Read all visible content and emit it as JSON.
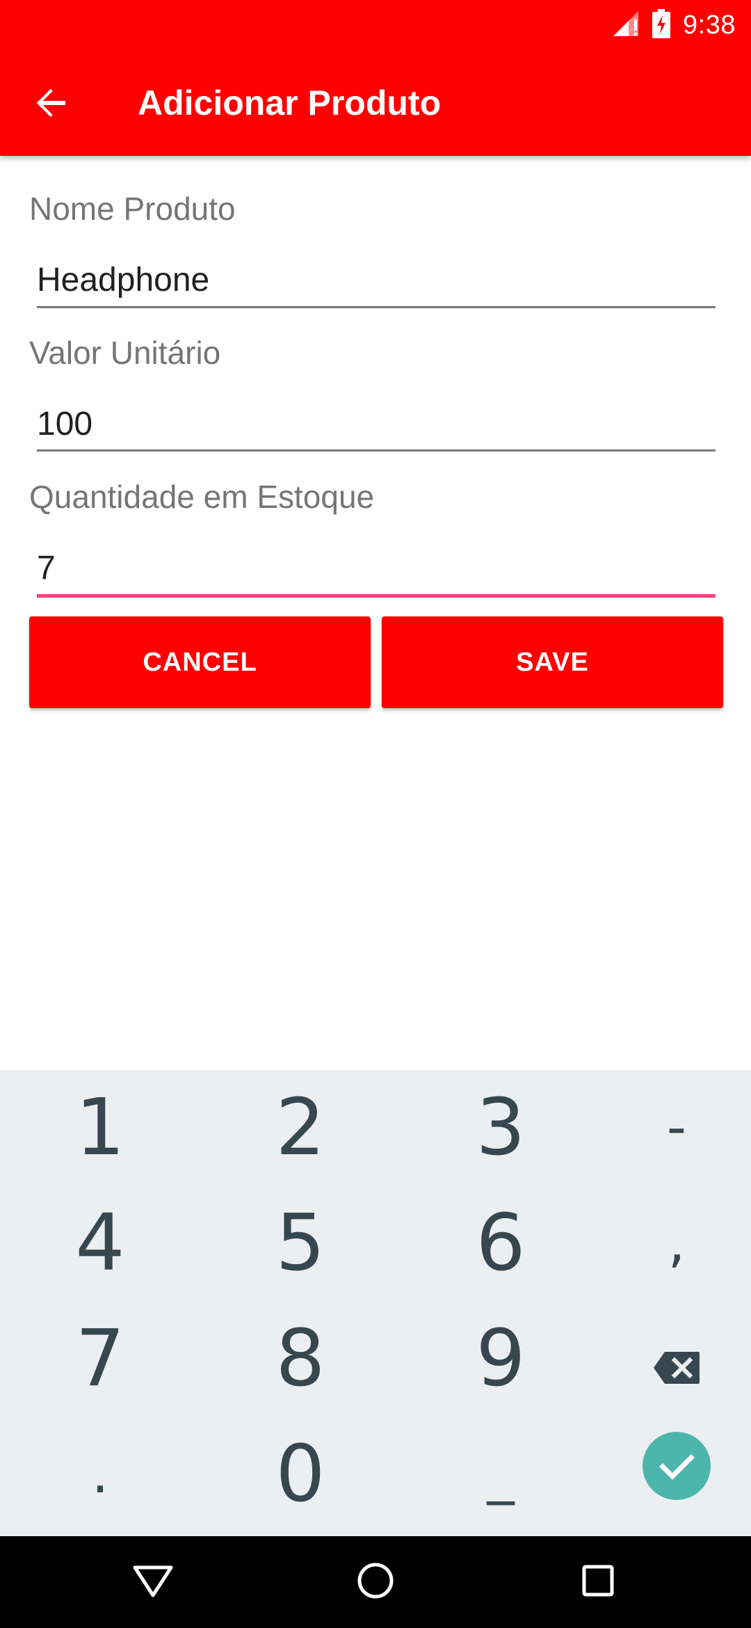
{
  "status_bar": {
    "time": "9:38"
  },
  "app_bar": {
    "title": "Adicionar Produto"
  },
  "form": {
    "fields": [
      {
        "label": "Nome Produto",
        "value": "Headphone"
      },
      {
        "label": "Valor Unitário",
        "value": "100"
      },
      {
        "label": "Quantidade em Estoque",
        "value": "7"
      }
    ],
    "cancel_label": "CANCEL",
    "save_label": "SAVE"
  },
  "keyboard": {
    "keys": [
      "1",
      "2",
      "3",
      "-",
      "4",
      "5",
      "6",
      ",",
      "7",
      "8",
      "9",
      "backspace",
      ".",
      "0",
      "_",
      "done"
    ]
  },
  "nav_bar": {
    "icons": [
      "back-triangle-icon",
      "home-circle-icon",
      "recents-square-icon"
    ]
  },
  "colors": {
    "primary": "#ff0000",
    "accent": "#ff4081",
    "keyboard_bg": "#eceff1",
    "done_key": "#4db6ac"
  }
}
